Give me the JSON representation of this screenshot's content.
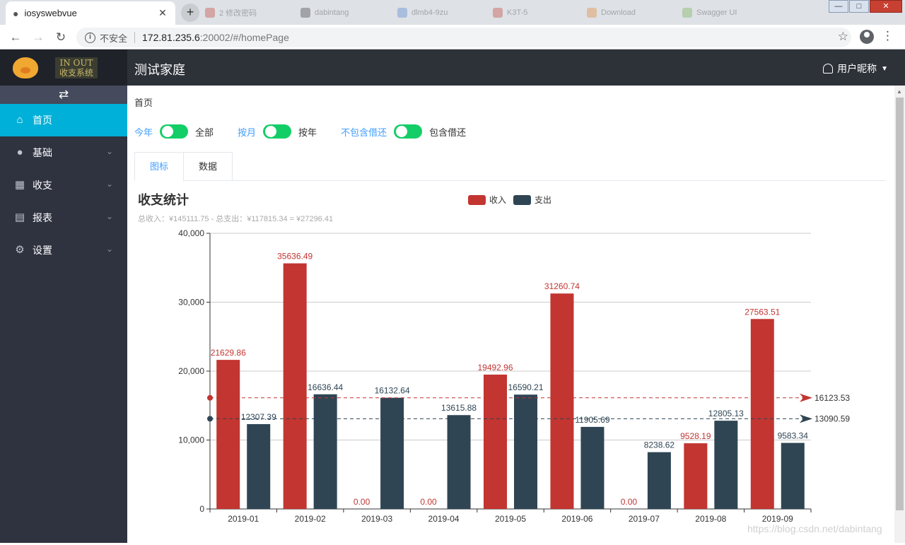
{
  "browser": {
    "tab_title": "iosyswebvue",
    "bg_tabs": [
      "2 修改密码",
      "dabintang",
      "dlmb4-9zu",
      "K3T-5",
      "Download",
      "Swagger UI"
    ],
    "security_label": "不安全",
    "url_host": "172.81.235.6",
    "url_rest": ":20002/#/homePage"
  },
  "sidebar": {
    "logo_line1": "IN OUT",
    "logo_line2": "收支系统",
    "items": [
      {
        "label": "首页",
        "icon": "home-icon",
        "active": true
      },
      {
        "label": "基础",
        "icon": "planet-icon"
      },
      {
        "label": "收支",
        "icon": "calculator-icon"
      },
      {
        "label": "报表",
        "icon": "report-icon"
      },
      {
        "label": "设置",
        "icon": "gear-icon"
      }
    ]
  },
  "header": {
    "family_name": "测试家庭",
    "user_name": "用户昵称"
  },
  "main": {
    "breadcrumb": "首页",
    "switches": [
      {
        "left": "今年",
        "right": "全部"
      },
      {
        "left": "按月",
        "right": "按年"
      },
      {
        "left": "不包含借还",
        "right": "包含借还"
      }
    ],
    "tabs": [
      "图标",
      "数据"
    ]
  },
  "chart_data": {
    "type": "bar",
    "title": "收支统计",
    "subtitle": "总收入：¥145111.75 - 总支出：¥117815.34 = ¥27296.41",
    "categories": [
      "2019-01",
      "2019-02",
      "2019-03",
      "2019-04",
      "2019-05",
      "2019-06",
      "2019-07",
      "2019-08",
      "2019-09"
    ],
    "series": [
      {
        "name": "收入",
        "color": "#c23531",
        "values": [
          21629.86,
          35636.49,
          0.0,
          0.0,
          19492.96,
          31260.74,
          0.0,
          9528.19,
          27563.51
        ],
        "average": 16123.53
      },
      {
        "name": "支出",
        "color": "#2f4554",
        "values": [
          12307.39,
          16636.44,
          16132.64,
          13615.88,
          16590.21,
          11905.69,
          8238.62,
          12805.13,
          9583.34
        ],
        "average": 13090.59
      }
    ],
    "ylim": [
      0,
      40000
    ],
    "yticks": [
      "0",
      "10,000",
      "20,000",
      "30,000",
      "40,000"
    ],
    "legend_position": "top-center",
    "grid": true
  },
  "watermark": "https://blog.csdn.net/dabintang"
}
